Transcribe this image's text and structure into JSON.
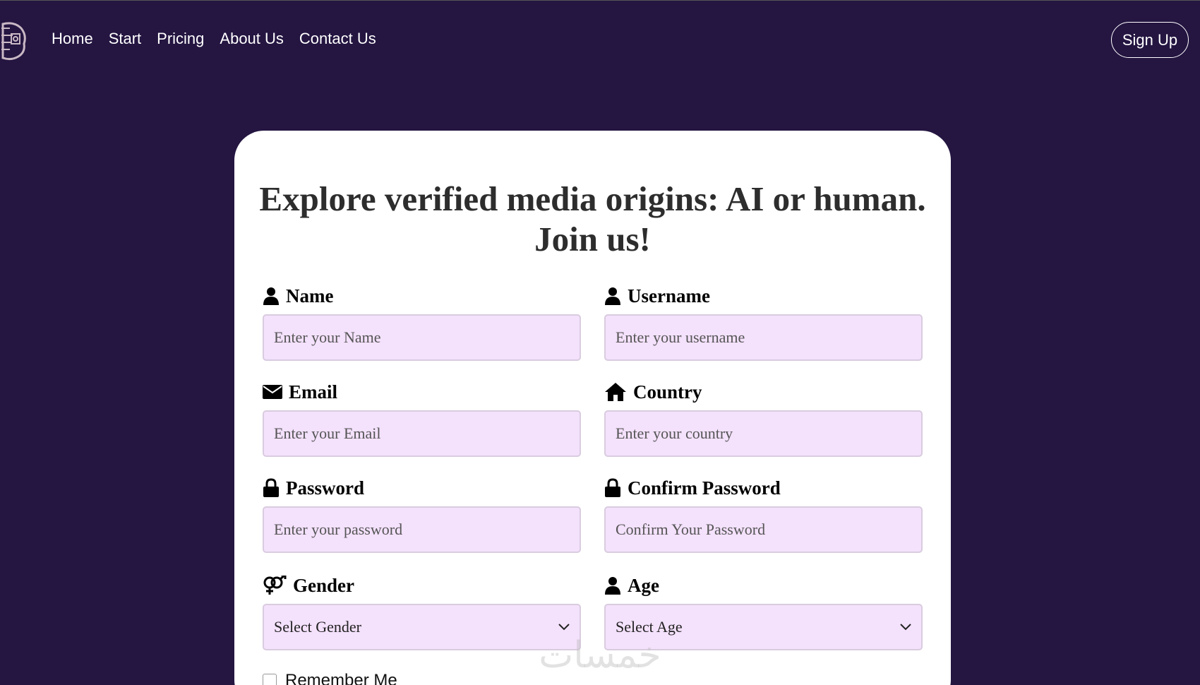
{
  "nav": {
    "links": [
      "Home",
      "Start",
      "Pricing",
      "About Us",
      "Contact Us"
    ],
    "signup_label": "Sign Up"
  },
  "form": {
    "title": "Explore verified media origins: AI or human. Join us!",
    "name": {
      "label": "Name",
      "placeholder": "Enter your Name",
      "icon": "user-icon"
    },
    "username": {
      "label": "Username",
      "placeholder": "Enter your username",
      "icon": "user-icon"
    },
    "email": {
      "label": "Email",
      "placeholder": "Enter your Email",
      "icon": "envelope-icon"
    },
    "country": {
      "label": "Country",
      "placeholder": "Enter your country",
      "icon": "home-icon"
    },
    "password": {
      "label": "Password",
      "placeholder": "Enter your password",
      "icon": "lock-icon"
    },
    "confirm_password": {
      "label": "Confirm Password",
      "placeholder": "Confirm Your Password",
      "icon": "lock-icon"
    },
    "gender": {
      "label": "Gender",
      "selected": "Select Gender",
      "icon": "venus-mars-icon"
    },
    "age": {
      "label": "Age",
      "selected": "Select Age",
      "icon": "user-icon"
    },
    "remember_label": "Remember Me"
  },
  "watermark": "خمسات",
  "colors": {
    "background": "#241541",
    "card": "#ffffff",
    "input_bg": "#f4e1fc",
    "input_border": "#d9ccdf"
  }
}
